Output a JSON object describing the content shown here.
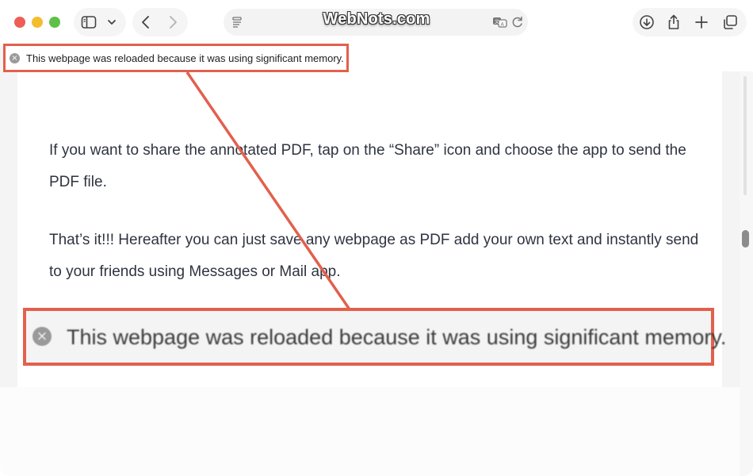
{
  "site": {
    "title": "WebNots.com"
  },
  "toolbar": {
    "icons": [
      "sidebar-icon",
      "chevron-down-icon",
      "back-icon",
      "forward-icon",
      "page-menu-icon",
      "translate-icon",
      "reload-icon",
      "download-icon",
      "share-icon",
      "plus-icon",
      "tabs-overview-icon"
    ]
  },
  "banner": {
    "message": "This webpage was reloaded because it was using significant memory.",
    "close_glyph": "×"
  },
  "article": {
    "paragraphs": [
      "If you want to share the annotated PDF, tap on the “Share” icon and choose the app to send the PDF file.",
      "That’s it!!! Hereafter you can just save any webpage as PDF add your own text and instantly send to your friends using Messages or Mail app."
    ]
  },
  "colors": {
    "highlight": "#e2604d",
    "text": "#2f3440"
  }
}
